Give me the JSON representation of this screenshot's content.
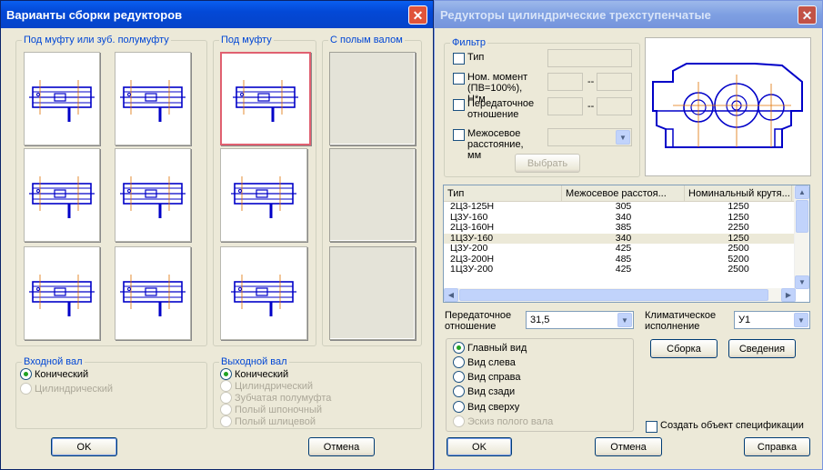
{
  "left_window": {
    "title": "Варианты сборки редукторов",
    "close_label": "✕",
    "groups": {
      "coupling": "Под муфту или зуб. полумуфту",
      "coupling_only": "Под муфту",
      "hollow_shaft": "С полым валом"
    },
    "input_shaft": {
      "label": "Входной вал",
      "options": [
        "Конический",
        "Цилиндрический"
      ],
      "selected": "Конический"
    },
    "output_shaft": {
      "label": "Выходной вал",
      "options": [
        "Конический",
        "Цилиндрический",
        "Зубчатая полумуфта",
        "Полый шпоночный",
        "Полый шлицевой"
      ],
      "selected": "Конический"
    },
    "ok_label": "OK",
    "cancel_label": "Отмена"
  },
  "right_window": {
    "title": "Редукторы цилиндрические трехступенчатые",
    "close_label": "✕",
    "filter": {
      "label": "Фильтр",
      "type_label": "Тип",
      "moment_label": "Ном. момент (ПВ=100%), Н*м",
      "ratio_label": "Передаточное отношение",
      "distance_label": "Межосевое расстояние, мм",
      "range_sep": "--",
      "select_label": "Выбрать"
    },
    "table": {
      "columns": [
        "Тип",
        "Межосевое расстоя...",
        "Номинальный крутя..."
      ],
      "rows": [
        [
          "2Ц3-125Н",
          "305",
          "1250"
        ],
        [
          "Ц3У-160",
          "340",
          "1250"
        ],
        [
          "2Ц3-160Н",
          "385",
          "2250"
        ],
        [
          "1Ц3У-160",
          "340",
          "1250"
        ],
        [
          "Ц3У-200",
          "425",
          "2500"
        ],
        [
          "2Ц3-200Н",
          "485",
          "5200"
        ],
        [
          "1Ц3У-200",
          "425",
          "2500"
        ]
      ],
      "selected_row": 3
    },
    "ratio": {
      "label": "Передаточное отношение",
      "value": "31,5"
    },
    "climate": {
      "label": "Климатическое исполнение",
      "value": "У1"
    },
    "views": {
      "options": [
        "Главный вид",
        "Вид слева",
        "Вид справа",
        "Вид сзади",
        "Вид сверху",
        "Эскиз полого вала"
      ],
      "selected": "Главный вид"
    },
    "assembly_label": "Сборка",
    "info_label": "Сведения",
    "spec_label": "Создать объект спецификации",
    "ok_label": "OK",
    "cancel_label": "Отмена",
    "help_label": "Справка"
  },
  "colors": {
    "drawing": "#0000c8",
    "accent_line": "#e07000",
    "selection": "#e06070"
  }
}
